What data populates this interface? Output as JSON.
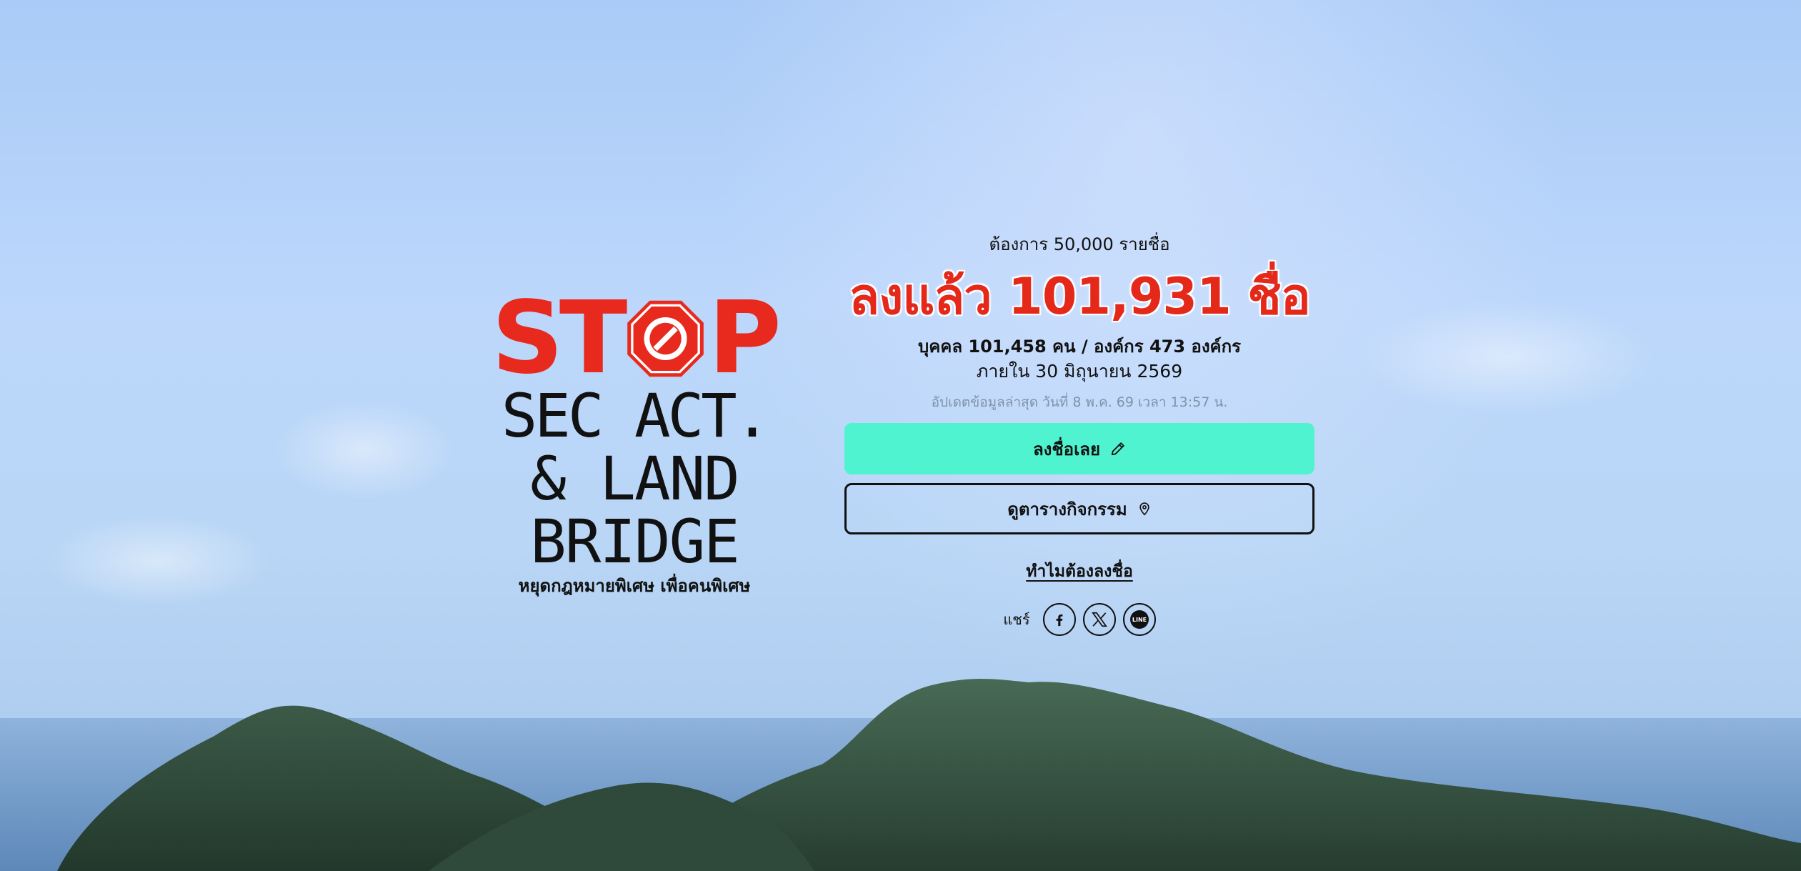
{
  "logo": {
    "stop_text": "STOP",
    "line_1": "SEC ACT.",
    "line_2": "& LAND",
    "line_3": "BRIDGE",
    "caption": "หยุดกฎหมายพิเศษ เพื่อคนพิเศษ",
    "accent_color": "#e8291e"
  },
  "campaign": {
    "target_text": "ต้องการ 50,000 รายชื่อ",
    "headline_text": "ลงแล้ว 101,931 ชื่อ",
    "breakdown_text": "บุคคล 101,458 คน / องค์กร 473 องค์กร",
    "deadline_text": "ภายใน 30 มิถุนายน 2569",
    "updated_text": "อัปเดตข้อมูลล่าสุด วันที่ 8 พ.ค. 69 เวลา 13:57 น.",
    "headline_color": "#e4291b"
  },
  "actions": {
    "sign_label": "ลงชื่อเลย",
    "sign_icon": "pencil-icon",
    "sign_color": "#50f3cf",
    "schedule_label": "ดูตารางกิจกรรม",
    "schedule_icon": "map-pin-icon",
    "why_label": "ทำไมต้องลงชื่อ"
  },
  "share": {
    "label": "แชร์",
    "networks": [
      {
        "name": "facebook",
        "icon": "facebook-icon"
      },
      {
        "name": "x",
        "icon": "x-icon"
      },
      {
        "name": "line",
        "icon": "line-icon",
        "text": "LINE"
      }
    ]
  }
}
